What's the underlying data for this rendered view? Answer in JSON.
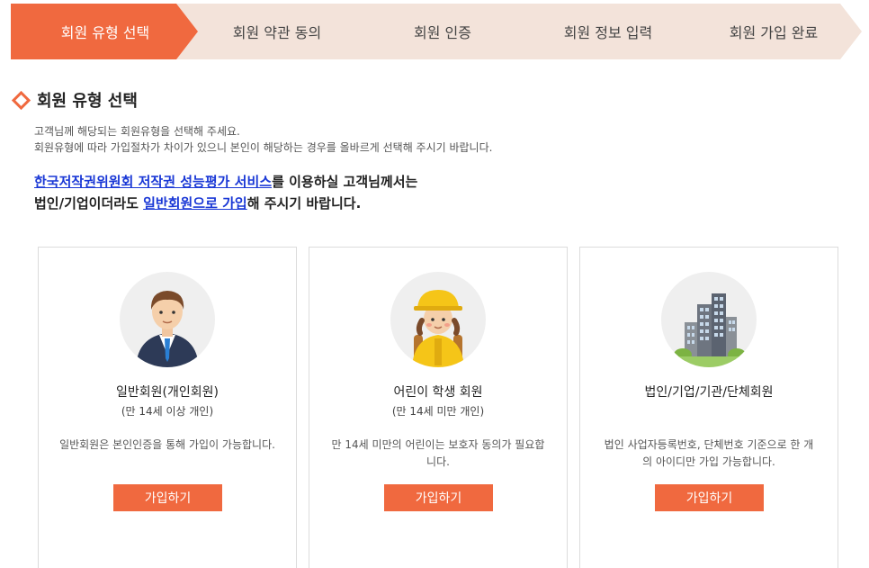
{
  "steps": [
    {
      "label": "회원 유형 선택",
      "active": true
    },
    {
      "label": "회원 약관 동의",
      "active": false
    },
    {
      "label": "회원 인증",
      "active": false
    },
    {
      "label": "회원 정보 입력",
      "active": false
    },
    {
      "label": "회원 가입 완료",
      "active": false
    }
  ],
  "section": {
    "title": "회원 유형 선택",
    "icon": "diamond-icon",
    "desc_line1": "고객님께 해당되는 회원유형을 선택해 주세요.",
    "desc_line2": "회원유형에 따라 가입절차가 차이가 있으니 본인이 해당하는 경우를 올바르게 선택해 주시기 바랍니다."
  },
  "notice": {
    "link1": "한국저작권위원회 저작권 성능평가 서비스",
    "text1": "를 이용하실 고객님께서는",
    "text2": "법인/기업이더라도 ",
    "link2": "일반회원으로 가입",
    "text3": "해 주시기 바랍니다."
  },
  "cards": [
    {
      "title": "일반회원(개인회원)",
      "sub": "(만 14세 이상 개인)",
      "text": "일반회원은 본인인증을 통해 가입이 가능합니다.",
      "button": "가입하기",
      "icon": "businessman-icon"
    },
    {
      "title": "어린이 학생 회원",
      "sub": "(만 14세 미만 개인)",
      "text": "만 14세 미만의 어린이는 보호자 동의가 필요합니다.",
      "button": "가입하기",
      "icon": "child-student-icon"
    },
    {
      "title": "법인/기업/기관/단체회원",
      "sub": "",
      "text": "법인 사업자등록번호, 단체번호 기준으로 한 개의 아이디만 가입 가능합니다.",
      "button": "가입하기",
      "icon": "building-icon"
    }
  ],
  "colors": {
    "accent": "#f0693f",
    "step_inactive": "#f3e3da",
    "link": "#1a38d6"
  }
}
